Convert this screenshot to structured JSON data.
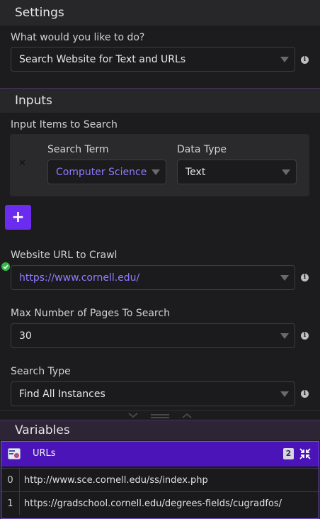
{
  "settings": {
    "title": "Settings",
    "action_label": "What would you like to do?",
    "action_value": "Search Website for Text and URLs"
  },
  "inputs": {
    "title": "Inputs",
    "items_label": "Input Items to Search",
    "item": {
      "search_term_label": "Search Term",
      "search_term_value": "Computer Science",
      "data_type_label": "Data Type",
      "data_type_value": "Text",
      "remove_glyph": "✕"
    },
    "add_glyph": "+",
    "website_label": "Website URL to Crawl",
    "website_value": "https://www.cornell.edu/",
    "max_pages_label": "Max Number of Pages To Search",
    "max_pages_value": "30",
    "search_type_label": "Search Type",
    "search_type_value": "Find All Instances"
  },
  "variables": {
    "title": "Variables",
    "panel": {
      "name": "URLs",
      "count": "2",
      "rows": [
        {
          "index": "0",
          "value": "http://www.sce.cornell.edu/ss/index.php"
        },
        {
          "index": "1",
          "value": "https://gradschool.cornell.edu/degrees-fields/cugradfos/"
        }
      ]
    }
  },
  "icons": {
    "info": "info-icon",
    "valid": "check-icon",
    "remove": "close-icon",
    "collapse": "compress-icon",
    "variable": "list-variable-icon",
    "resize": "drag-handle-icon"
  },
  "colors": {
    "accent": "#6b2cf0",
    "variables_header": "#4a14b8",
    "link_text": "#8f7bff",
    "valid": "#35b84a"
  }
}
